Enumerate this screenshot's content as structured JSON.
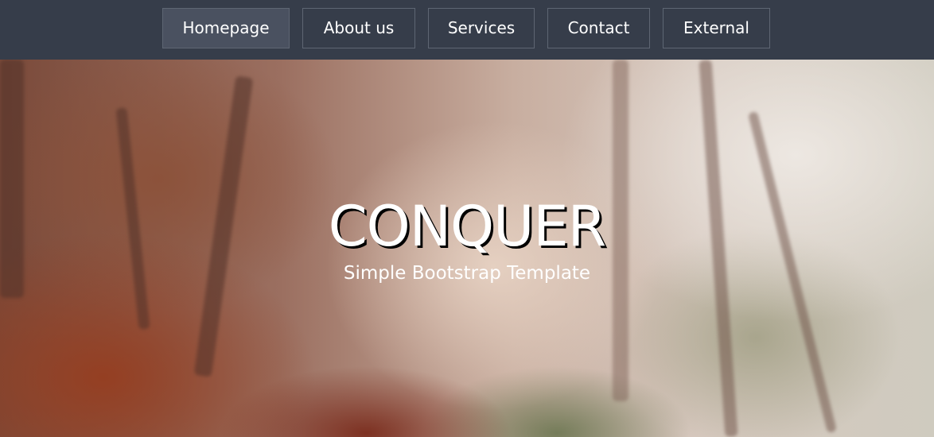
{
  "nav": {
    "items": [
      {
        "label": "Homepage",
        "active": true
      },
      {
        "label": "About us",
        "active": false
      },
      {
        "label": "Services",
        "active": false
      },
      {
        "label": "Contact",
        "active": false
      },
      {
        "label": "External",
        "active": false
      }
    ]
  },
  "hero": {
    "title": "CONQUER",
    "subtitle": "Simple Bootstrap Template"
  },
  "colors": {
    "navbar_bg": "#363d4a",
    "nav_active_bg": "#4a5160",
    "nav_border": "#5e6673",
    "text": "#ffffff"
  }
}
